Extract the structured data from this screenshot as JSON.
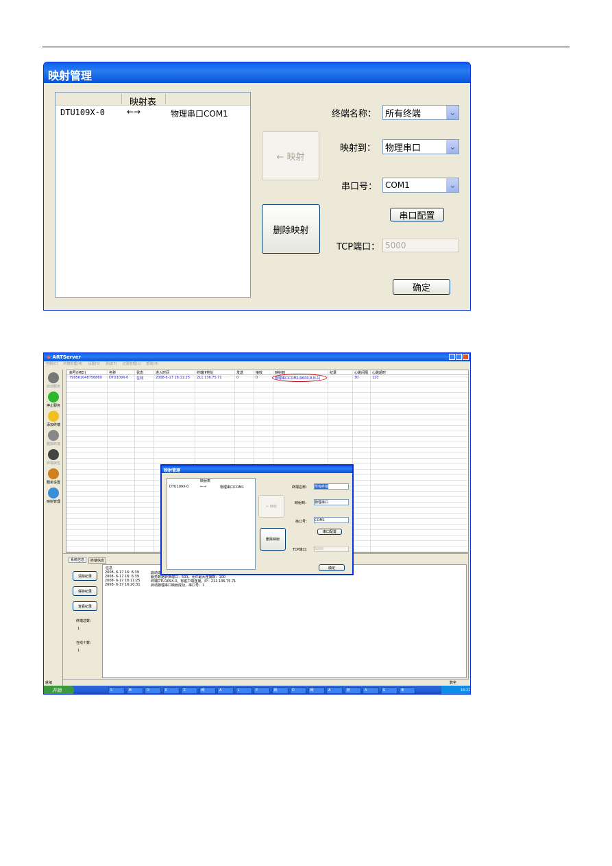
{
  "dialog": {
    "title": "映射管理",
    "list_header": "映射表",
    "mapping": {
      "terminal": "DTU109X-0",
      "arrow": "←→",
      "target": "物理串口COM1"
    },
    "map_button": "← 映射",
    "delete_button": "删除映射",
    "terminal_label": "终端名称：",
    "terminal_value": "所有终端",
    "mapto_label": "映射到：",
    "mapto_value": "物理串口",
    "port_label": "串口号：",
    "port_value": "COM1",
    "port_config_button": "串口配置",
    "tcp_label": "TCP端口：",
    "tcp_value": "5000",
    "ok_button": "确定"
  },
  "app": {
    "title": "ARTServer",
    "menu": [
      "控制(C)",
      "终端管理(M)",
      "设置(S)",
      "测试(T)",
      "记录管理(L)",
      "帮助(H)"
    ],
    "toolbar": [
      {
        "label": "启动服务",
        "icon": "play-icon",
        "enabled": false
      },
      {
        "label": "停止服务",
        "icon": "stop-icon",
        "enabled": true
      },
      {
        "label": "添加终端",
        "icon": "star-add-icon",
        "enabled": true
      },
      {
        "label": "删除终端",
        "icon": "delete-icon",
        "enabled": false
      },
      {
        "label": "终端属性",
        "icon": "device-icon",
        "enabled": false
      },
      {
        "label": "服务设置",
        "icon": "settings-icon",
        "enabled": true
      },
      {
        "label": "映射管理",
        "icon": "mapping-icon",
        "enabled": true
      }
    ],
    "columns": [
      "串号(IMEI)",
      "名称",
      "状态",
      "连入时间",
      "终端IP地址",
      "发送",
      "接收",
      "映射到",
      "纪录",
      "心跳间隔",
      "心跳超时"
    ],
    "rows": [
      [
        "799561048756869",
        "DTU109X-0",
        "在线",
        "2008-6-17 16:11:25",
        "211.136.75.71",
        "0",
        "0",
        "物理串口COM1(9600,8,N,1)",
        "",
        "30",
        "120"
      ]
    ],
    "tabs": [
      "系统信息",
      "终端信息"
    ],
    "buttons": [
      "清除纪录",
      "保存纪录",
      "查看纪录"
    ],
    "total_label": "终端总数：",
    "total_value": "1",
    "online_label": "在线个数：",
    "online_value": "1",
    "log_header": "信息",
    "log": [
      [
        "2008- 6-17 16: 6:39",
        "启动成功"
      ],
      [
        "2008- 6-17 16: 6:39",
        "服务数据转换端口：503，允许最大连接数：100"
      ],
      [
        "2008- 6-17 16:11:25",
        "终端DTU109X-0，有客户端连接，IP：211.136.75.71"
      ],
      [
        "2008- 6-17 16:20:31",
        "启动物理串口映射成功，串口号：1"
      ]
    ],
    "status_left": "就绪",
    "status_right": "数字",
    "start_label": "开始",
    "clock": "16:21",
    "task_items": [
      "S",
      "M",
      "D",
      "D",
      "工",
      "网",
      "A",
      "L",
      "E",
      "网",
      "D",
      "网",
      "A",
      "测",
      "A",
      "G",
      "未"
    ]
  },
  "colors": {
    "titlebar": "#0a5fe8",
    "window_bg": "#ece9d8",
    "highlight": "#1a1acc",
    "annotation": "#cc0000"
  }
}
